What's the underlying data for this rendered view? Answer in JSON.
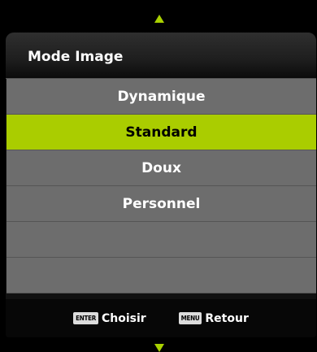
{
  "header": {
    "title": "Mode Image"
  },
  "menu": {
    "items": [
      {
        "label": "Dynamique",
        "selected": false
      },
      {
        "label": "Standard",
        "selected": true
      },
      {
        "label": "Doux",
        "selected": false
      },
      {
        "label": "Personnel",
        "selected": false
      },
      {
        "label": "",
        "selected": false
      },
      {
        "label": "",
        "selected": false
      }
    ]
  },
  "footer": {
    "enter_key": "ENTER",
    "enter_label": "Choisir",
    "menu_key": "MENU",
    "menu_label": "Retour"
  },
  "colors": {
    "accent": "#aacd00",
    "row": "#6d6d6d",
    "background": "#000000"
  },
  "icons": {
    "scroll_up": "scroll-up-arrow-icon",
    "scroll_down": "scroll-down-arrow-icon"
  }
}
